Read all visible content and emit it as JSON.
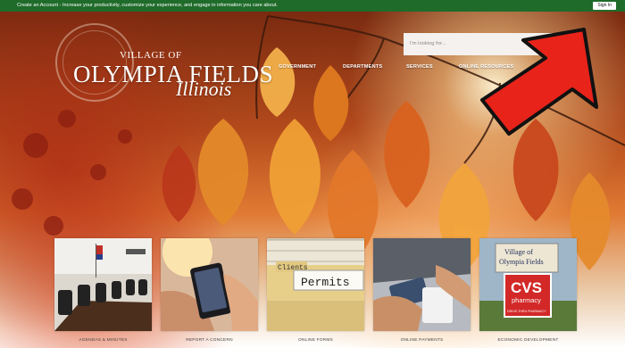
{
  "topbar": {
    "message": "Create an Account - Increase your productivity, customize your experience, and engage in information you care about.",
    "signin_label": "Sign In"
  },
  "logo": {
    "seal_text_top": "VILLAGE OF",
    "seal_text_bottom": "OLYMPIA FIELDS",
    "small": "VILLAGE OF",
    "main": "OLYMPIA FIELDS",
    "script": "Illinois"
  },
  "search": {
    "placeholder": "I'm looking for..."
  },
  "nav": {
    "items": [
      {
        "label": "GOVERNMENT"
      },
      {
        "label": "DEPARTMENTS"
      },
      {
        "label": "SERVICES"
      },
      {
        "label": "ONLINE RESOURCES"
      }
    ]
  },
  "tiles": [
    {
      "label": "AGENDAS & MINUTES"
    },
    {
      "label": "REPORT A CONCERN"
    },
    {
      "label": "ONLINE FORMS",
      "folder_tab": "Clients",
      "folder_label": "Permits"
    },
    {
      "label": "ONLINE PAYMENTS"
    },
    {
      "label": "ECONOMIC DEVELOPMENT",
      "sign_text_1": "Village of",
      "sign_text_2": "Olympia Fields",
      "store_logo": "CVS",
      "store_sub": "pharmacy",
      "store_tag": "DRIVE-THRU PHARMACY"
    }
  ],
  "colors": {
    "topbar": "#1f6b2a",
    "arrow": "#e8231a",
    "leaf_orange": "#e07a20",
    "leaf_red": "#b8321a"
  }
}
